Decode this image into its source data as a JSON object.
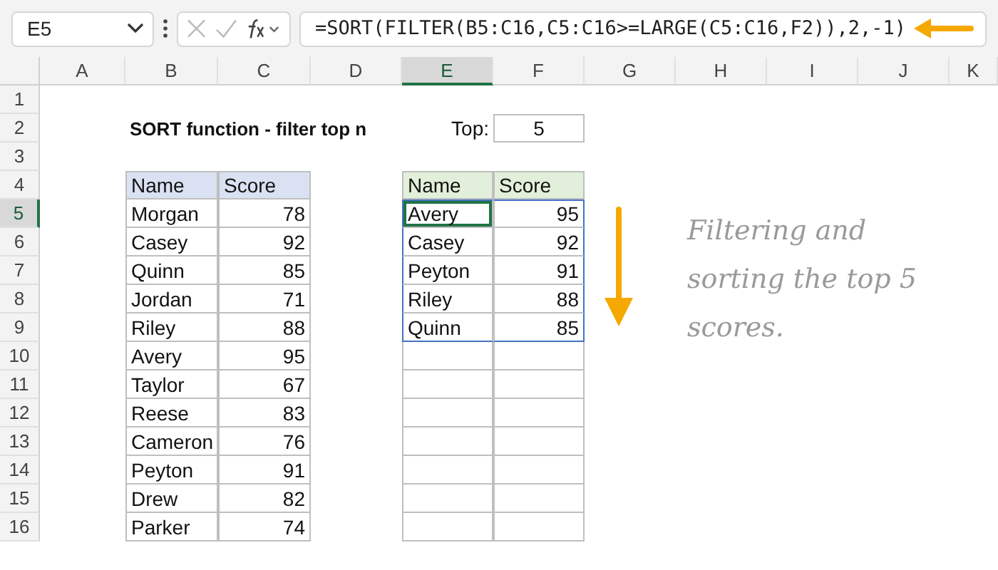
{
  "name_box": "E5",
  "formula": "=SORT(FILTER(B5:C16,C5:C16>=LARGE(C5:C16,F2)),2,-1)",
  "columns": [
    {
      "label": "A",
      "selected": false
    },
    {
      "label": "B",
      "selected": false
    },
    {
      "label": "C",
      "selected": false
    },
    {
      "label": "D",
      "selected": false
    },
    {
      "label": "E",
      "selected": true
    },
    {
      "label": "F",
      "selected": false
    },
    {
      "label": "G",
      "selected": false
    },
    {
      "label": "H",
      "selected": false
    },
    {
      "label": "I",
      "selected": false
    },
    {
      "label": "J",
      "selected": false
    },
    {
      "label": "K",
      "selected": false
    }
  ],
  "rows": [
    {
      "label": "1",
      "selected": false
    },
    {
      "label": "2",
      "selected": false
    },
    {
      "label": "3",
      "selected": false
    },
    {
      "label": "4",
      "selected": false
    },
    {
      "label": "5",
      "selected": true
    },
    {
      "label": "6",
      "selected": false
    },
    {
      "label": "7",
      "selected": false
    },
    {
      "label": "8",
      "selected": false
    },
    {
      "label": "9",
      "selected": false
    },
    {
      "label": "10",
      "selected": false
    },
    {
      "label": "11",
      "selected": false
    },
    {
      "label": "12",
      "selected": false
    },
    {
      "label": "13",
      "selected": false
    },
    {
      "label": "14",
      "selected": false
    },
    {
      "label": "15",
      "selected": false
    },
    {
      "label": "16",
      "selected": false
    }
  ],
  "title": "SORT function - filter top n",
  "top": {
    "label": "Top:",
    "value": "5"
  },
  "source_table": {
    "columns": [
      "Name",
      "Score"
    ],
    "rows": [
      {
        "name": "Morgan",
        "score": "78"
      },
      {
        "name": "Casey",
        "score": "92"
      },
      {
        "name": "Quinn",
        "score": "85"
      },
      {
        "name": "Jordan",
        "score": "71"
      },
      {
        "name": "Riley",
        "score": "88"
      },
      {
        "name": "Avery",
        "score": "95"
      },
      {
        "name": "Taylor",
        "score": "67"
      },
      {
        "name": "Reese",
        "score": "83"
      },
      {
        "name": "Cameron",
        "score": "76"
      },
      {
        "name": "Peyton",
        "score": "91"
      },
      {
        "name": "Drew",
        "score": "82"
      },
      {
        "name": "Parker",
        "score": "74"
      }
    ]
  },
  "result_table": {
    "columns": [
      "Name",
      "Score"
    ],
    "rows": [
      {
        "name": "Avery",
        "score": "95",
        "active": true
      },
      {
        "name": "Casey",
        "score": "92",
        "active": false
      },
      {
        "name": "Peyton",
        "score": "91",
        "active": false
      },
      {
        "name": "Riley",
        "score": "88",
        "active": false
      },
      {
        "name": "Quinn",
        "score": "85",
        "active": false
      }
    ]
  },
  "note": "Filtering and sorting the top 5 scores."
}
